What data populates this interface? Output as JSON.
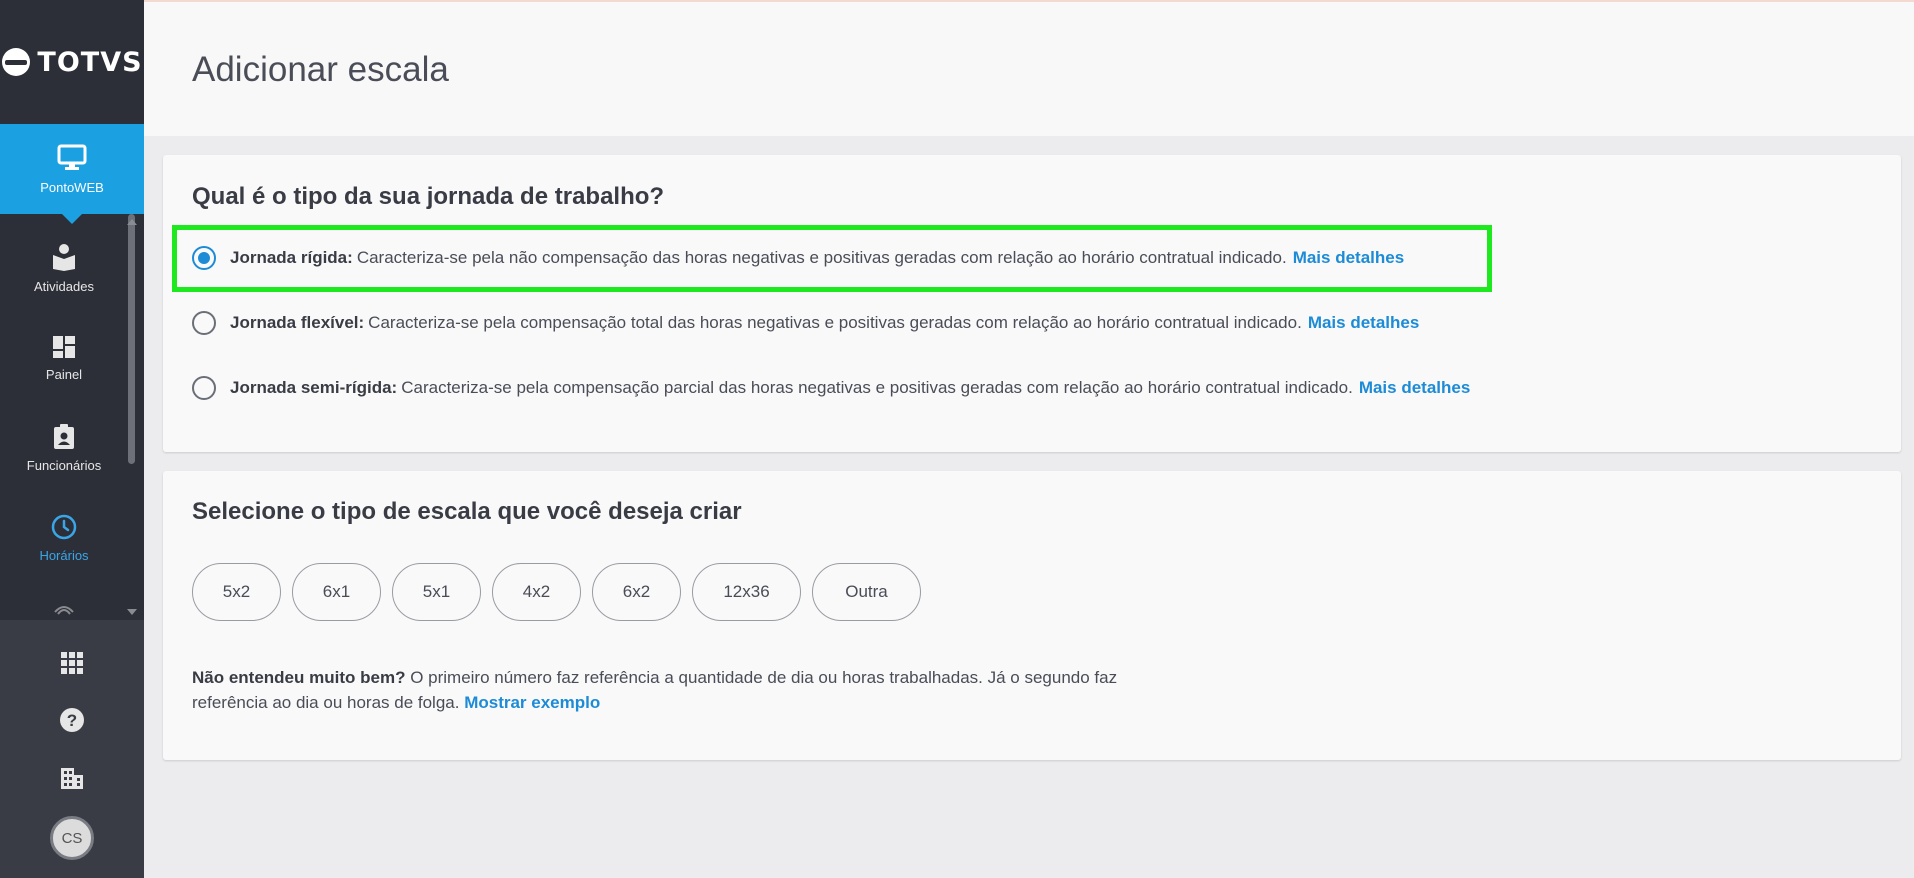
{
  "app": {
    "logo_text": "TOTVS"
  },
  "sidebar": {
    "primary": {
      "label": "PontoWEB"
    },
    "items": [
      {
        "label": "Atividades",
        "icon": "book-reader-icon"
      },
      {
        "label": "Painel",
        "icon": "dashboard-icon"
      },
      {
        "label": "Funcionários",
        "icon": "badge-icon"
      },
      {
        "label": "Horários",
        "icon": "clock-icon",
        "current": true
      }
    ],
    "bottom_icons": [
      "apps-grid-icon",
      "help-icon",
      "building-icon"
    ],
    "avatar_initials": "CS"
  },
  "header": {
    "title": "Adicionar escala"
  },
  "journey": {
    "title": "Qual é o tipo da sua jornada de trabalho?",
    "options": [
      {
        "name": "Jornada rígida:",
        "description": "Caracteriza-se pela não compensação das horas negativas e positivas geradas com relação ao horário contratual indicado.",
        "link": "Mais detalhes",
        "selected": true
      },
      {
        "name": "Jornada flexível:",
        "description": "Caracteriza-se pela compensação total das horas negativas e positivas geradas com relação ao horário contratual indicado.",
        "link": "Mais detalhes",
        "selected": false
      },
      {
        "name": "Jornada semi-rígida:",
        "description": "Caracteriza-se pela compensação parcial das horas negativas e positivas geradas com relação ao horário contratual indicado.",
        "link": "Mais detalhes",
        "selected": false
      }
    ]
  },
  "scale": {
    "title": "Selecione o tipo de escala que você deseja criar",
    "chips": [
      "5x2",
      "6x1",
      "5x1",
      "4x2",
      "6x2",
      "12x36",
      "Outra"
    ],
    "help_bold": "Não entendeu muito bem?",
    "help_text": "O primeiro número faz referência a quantidade de dia ou horas trabalhadas. Já o segundo faz referência ao dia ou horas de folga.",
    "help_link": "Mostrar exemplo"
  },
  "colors": {
    "accent": "#1d8bd6",
    "primary_nav": "#1ba1e2",
    "sidebar_bg": "#2d2f38",
    "highlight": "#1ee81e"
  }
}
